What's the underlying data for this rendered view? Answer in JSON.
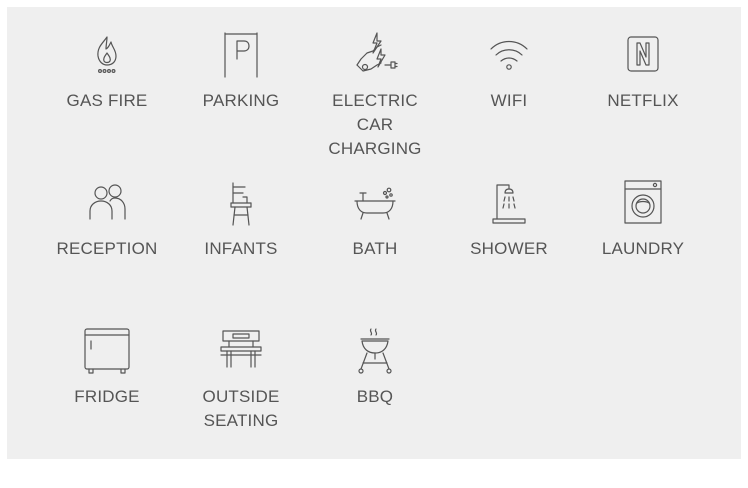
{
  "amenities": [
    {
      "label": "GAS FIRE",
      "icon": "fire-icon"
    },
    {
      "label": "PARKING",
      "icon": "parking-icon"
    },
    {
      "label": "ELECTRIC\nCAR\nCHARGING",
      "icon": "electric-car-icon"
    },
    {
      "label": "WIFI",
      "icon": "wifi-icon"
    },
    {
      "label": "NETFLIX",
      "icon": "netflix-icon"
    },
    {
      "label": "RECEPTION",
      "icon": "people-icon"
    },
    {
      "label": "INFANTS",
      "icon": "high-chair-icon"
    },
    {
      "label": "BATH",
      "icon": "bathtub-icon"
    },
    {
      "label": "SHOWER",
      "icon": "shower-icon"
    },
    {
      "label": "LAUNDRY",
      "icon": "washing-machine-icon"
    },
    {
      "label": "FRIDGE",
      "icon": "fridge-icon"
    },
    {
      "label": "OUTSIDE\nSEATING",
      "icon": "bench-icon"
    },
    {
      "label": "BBQ",
      "icon": "grill-icon"
    }
  ],
  "colors": {
    "panel_background": "#efefef",
    "icon_stroke": "#555555",
    "label_text": "#555555"
  }
}
